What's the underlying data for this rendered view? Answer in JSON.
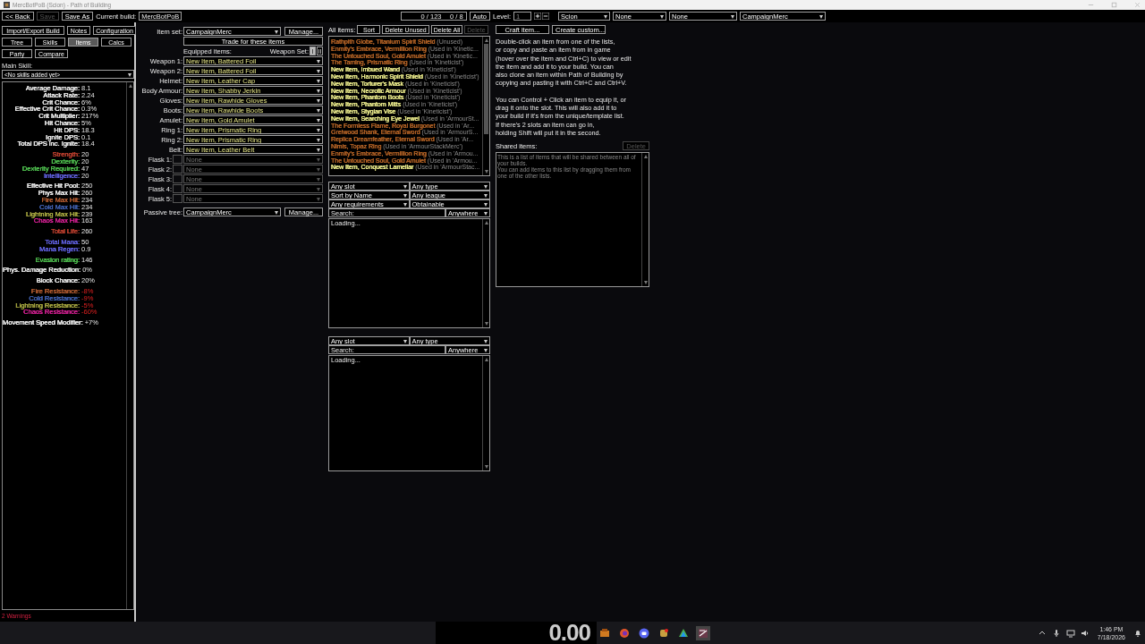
{
  "window": {
    "title": "MercBotPoB (Scion) - Path of Building"
  },
  "toolbar": {
    "back": "<< Back",
    "save": {
      "label": "Save",
      "disabled": true
    },
    "save_as": "Save As",
    "current_build_label": "Current build:",
    "current_build": "MercBotPoB",
    "points": "0 / 123",
    "ascendancy_points": "0 / 8",
    "auto": "Auto",
    "level_label": "Level:",
    "level": "1",
    "class": "Scion",
    "ascendancy": "None",
    "bandit": "None",
    "config": "CampaignMerc"
  },
  "nav_rows": [
    [
      {
        "label": "Import/Export Build",
        "selected": false
      },
      {
        "label": "Notes",
        "selected": false
      },
      {
        "label": "Configuration",
        "selected": false
      }
    ],
    [
      {
        "label": "Tree",
        "selected": false
      },
      {
        "label": "Skills",
        "selected": false
      },
      {
        "label": "Items",
        "selected": true
      },
      {
        "label": "Calcs",
        "selected": false
      }
    ],
    [
      {
        "label": "Party",
        "selected": false
      },
      {
        "label": "Compare",
        "selected": false
      }
    ]
  ],
  "main_skill": {
    "label": "Main Skill:",
    "value": "<No skills added yet>"
  },
  "stat_groups": [
    [
      {
        "label": "Average Damage:",
        "value": "8.1"
      },
      {
        "label": "Attack Rate:",
        "value": "2.24"
      },
      {
        "label": "Crit Chance:",
        "value": "6%"
      },
      {
        "label": "Effective Crit Chance:",
        "value": "0.3%"
      },
      {
        "label": "Crit Multiplier:",
        "value": "217%"
      },
      {
        "label": "Hit Chance:",
        "value": "5%"
      },
      {
        "label": "Hit DPS:",
        "value": "18.3"
      },
      {
        "label": "Ignite DPS:",
        "value": "0.1"
      },
      {
        "label": "Total DPS inc. Ignite:",
        "value": "18.4"
      }
    ],
    [
      {
        "label": "Strength:",
        "value": "20",
        "color": "#c0402f"
      },
      {
        "label": "Dexterity:",
        "value": "20",
        "color": "#4fc04f"
      },
      {
        "label": "Dexterity Required:",
        "value": "47",
        "color": "#4fc04f"
      },
      {
        "label": "Intelligence:",
        "value": "20",
        "color": "#6060e0"
      }
    ],
    [
      {
        "label": "Effective Hit Pool:",
        "value": "250"
      },
      {
        "label": "Phys Max Hit:",
        "value": "260"
      },
      {
        "label": "Fire Max Hit:",
        "value": "234",
        "color": "#b05a30"
      },
      {
        "label": "Cold Max Hit:",
        "value": "234",
        "color": "#4060b0"
      },
      {
        "label": "Lightning Max Hit:",
        "value": "239",
        "color": "#a8a840"
      },
      {
        "label": "Chaos Max Hit:",
        "value": "163",
        "color": "#d02090"
      }
    ],
    [
      {
        "label": "Total Life:",
        "value": "260",
        "color": "#c0402f"
      }
    ],
    [
      {
        "label": "Total Mana:",
        "value": "50",
        "color": "#6060e0"
      },
      {
        "label": "Mana Regen:",
        "value": "0.9",
        "color": "#6060e0"
      }
    ],
    [
      {
        "label": "Evasion rating:",
        "value": "146",
        "color": "#4fc04f"
      }
    ],
    [
      {
        "label": "Phys. Damage Reduction:",
        "value": "0%"
      }
    ],
    [
      {
        "label": "Block Chance:",
        "value": "20%"
      }
    ],
    [
      {
        "label": "Fire Resistance:",
        "value": "-8%",
        "color": "#b05a30",
        "negative": true
      },
      {
        "label": "Cold Resistance:",
        "value": "-9%",
        "color": "#4060b0",
        "negative": true
      },
      {
        "label": "Lightning Resistance:",
        "value": "-5%",
        "color": "#a8a840",
        "negative": true
      },
      {
        "label": "Chaos Resistance:",
        "value": "-60%",
        "color": "#d02090",
        "negative": true
      }
    ],
    [
      {
        "label": "Movement Speed Modifier:",
        "value": "+7%"
      }
    ]
  ],
  "warnings": "2 Warnings",
  "items_panel": {
    "item_set_label": "Item set:",
    "item_set": "CampaignMerc",
    "manage": "Manage...",
    "trade": "Trade for these items",
    "equipped_label": "Equipped items:",
    "weapon_set_label": "Weapon Set:",
    "weapon_sets": [
      {
        "label": "I",
        "selected": true
      },
      {
        "label": "II",
        "selected": false
      }
    ],
    "slots": [
      {
        "kind": "slot",
        "label": "Weapon 1:",
        "value": "New Item, Battered Foil",
        "empty": false
      },
      {
        "kind": "slot",
        "label": "Weapon 2:",
        "value": "New Item, Battered Foil",
        "empty": false
      },
      {
        "kind": "slot",
        "label": "Helmet:",
        "value": "New Item, Leather Cap",
        "empty": false
      },
      {
        "kind": "slot",
        "label": "Body Armour:",
        "value": "New Item, Shabby Jerkin",
        "empty": false
      },
      {
        "kind": "slot",
        "label": "Gloves:",
        "value": "New Item, Rawhide Gloves",
        "empty": false
      },
      {
        "kind": "slot",
        "label": "Boots:",
        "value": "New Item, Rawhide Boots",
        "empty": false
      },
      {
        "kind": "slot",
        "label": "Amulet:",
        "value": "New Item, Gold Amulet",
        "empty": false
      },
      {
        "kind": "slot",
        "label": "Ring 1:",
        "value": "New Item, Prismatic Ring",
        "empty": false
      },
      {
        "kind": "slot",
        "label": "Ring 2:",
        "value": "New Item, Prismatic Ring",
        "empty": false
      },
      {
        "kind": "slot",
        "label": "Belt:",
        "value": "New Item, Leather Belt",
        "empty": false
      },
      {
        "kind": "flask",
        "label": "Flask 1:",
        "value": "None",
        "empty": true,
        "checked": false
      },
      {
        "kind": "flask",
        "label": "Flask 2:",
        "value": "None",
        "empty": true,
        "checked": false
      },
      {
        "kind": "flask",
        "label": "Flask 3:",
        "value": "None",
        "empty": true,
        "checked": false
      },
      {
        "kind": "flask",
        "label": "Flask 4:",
        "value": "None",
        "empty": true,
        "checked": false
      },
      {
        "kind": "flask",
        "label": "Flask 5:",
        "value": "None",
        "empty": true,
        "checked": false
      }
    ],
    "passive_label": "Passive tree:",
    "passive": "CampaignMerc",
    "passive_manage": "Manage..."
  },
  "all_items": {
    "label": "All items:",
    "sort": "Sort",
    "delete_unused": "Delete Unused",
    "delete_all": "Delete All",
    "delete": {
      "label": "Delete",
      "disabled": true
    },
    "items": [
      {
        "name": "Rathpith Globe, Titanium Spirit Shield",
        "note": "(Unused)",
        "color": "#af6025"
      },
      {
        "name": "Enmity's Embrace, Vermillion Ring",
        "note": "(Used in 'Kinetic...",
        "color": "#af6025"
      },
      {
        "name": "The Untouched Soul, Gold Amulet",
        "note": "(Used in 'Kinetic...",
        "color": "#af6025"
      },
      {
        "name": "The Taming, Prismatic Ring",
        "note": "(Used in 'Kineticist')",
        "color": "#af6025"
      },
      {
        "name": "New Item, Imbued Wand",
        "note": "(Used in 'Kineticist')",
        "color": "#e8e88a"
      },
      {
        "name": "New Item, Harmonic Spirit Shield",
        "note": "(Used in 'Kineticist')",
        "color": "#e8e88a"
      },
      {
        "name": "New Item, Torturer's Mask",
        "note": "(Used in 'Kineticist')",
        "color": "#e8e88a"
      },
      {
        "name": "New Item, Necrotic Armour",
        "note": "(Used in 'Kineticist')",
        "color": "#e8e88a"
      },
      {
        "name": "New Item, Phantom Boots",
        "note": "(Used in 'Kineticist')",
        "color": "#e8e88a"
      },
      {
        "name": "New Item, Phantom Mitts",
        "note": "(Used in 'Kineticist')",
        "color": "#e8e88a"
      },
      {
        "name": "New Item, Stygian Vise",
        "note": "(Used in 'Kineticist')",
        "color": "#e8e88a"
      },
      {
        "name": "New Item, Searching Eye Jewel",
        "note": "(Used in 'ArmourSt...",
        "color": "#e8e88a"
      },
      {
        "name": "The Formless Flame, Royal Burgonet",
        "note": "(Used in 'Ar...",
        "color": "#af6025"
      },
      {
        "name": "Grelwood Shank, Eternal Sword",
        "note": "(Used in 'ArmourS...",
        "color": "#af6025"
      },
      {
        "name": "Replica Dreamfeather, Eternal Sword",
        "note": "(Used in 'Ar...",
        "color": "#af6025"
      },
      {
        "name": "Nimis, Topaz Ring",
        "note": "(Used in 'ArmourStackMerc')",
        "color": "#af6025"
      },
      {
        "name": "Enmity's Embrace, Vermillion Ring",
        "note": "(Used in 'Armou...",
        "color": "#af6025"
      },
      {
        "name": "The Untouched Soul, Gold Amulet",
        "note": "(Used in 'Armou...",
        "color": "#af6025"
      },
      {
        "name": "New Item, Conquest Lamellar",
        "note": "(Used in 'ArmourStac...",
        "color": "#e8e88a"
      }
    ]
  },
  "unique_db": {
    "filters": [
      [
        "Any slot",
        "Any type"
      ],
      [
        "Sort by Name",
        "Any league"
      ],
      [
        "Any requirements",
        "Obtainable"
      ]
    ],
    "search_label": "Search:",
    "search_scope": "Anywhere",
    "status": "Loading..."
  },
  "rare_db": {
    "filters": [
      [
        "Any slot",
        "Any type"
      ]
    ],
    "search_label": "Search:",
    "search_scope": "Anywhere",
    "status": "Loading..."
  },
  "help": {
    "craft": "Craft item...",
    "create": "Create custom...",
    "paragraphs": [
      "Double-click an item from one of the lists,\nor copy and paste an item from in game\n(hover over the item and Ctrl+C) to view or edit\nthe item and add it to your build. You can\nalso clone an item within Path of Building by\ncopying and pasting it with Ctrl+C and Ctrl+V.",
      "You can Control + Click an item to equip it, or\ndrag it onto the slot.  This will also add it to\nyour build if it's from the unique/template list.\nIf there's 2 slots an item can go in,\nholding Shift will put it in the second."
    ],
    "shared_label": "Shared items:",
    "shared_delete": {
      "label": "Delete",
      "disabled": true
    },
    "shared_hint": [
      "This is a list of items that will be shared between all of\nyour builds.",
      "You can add items to this list by dragging them from\none of the other lists."
    ]
  },
  "taskbar": {
    "timer": "0.00",
    "time": "1:46 PM",
    "date": "7/18/2026"
  }
}
